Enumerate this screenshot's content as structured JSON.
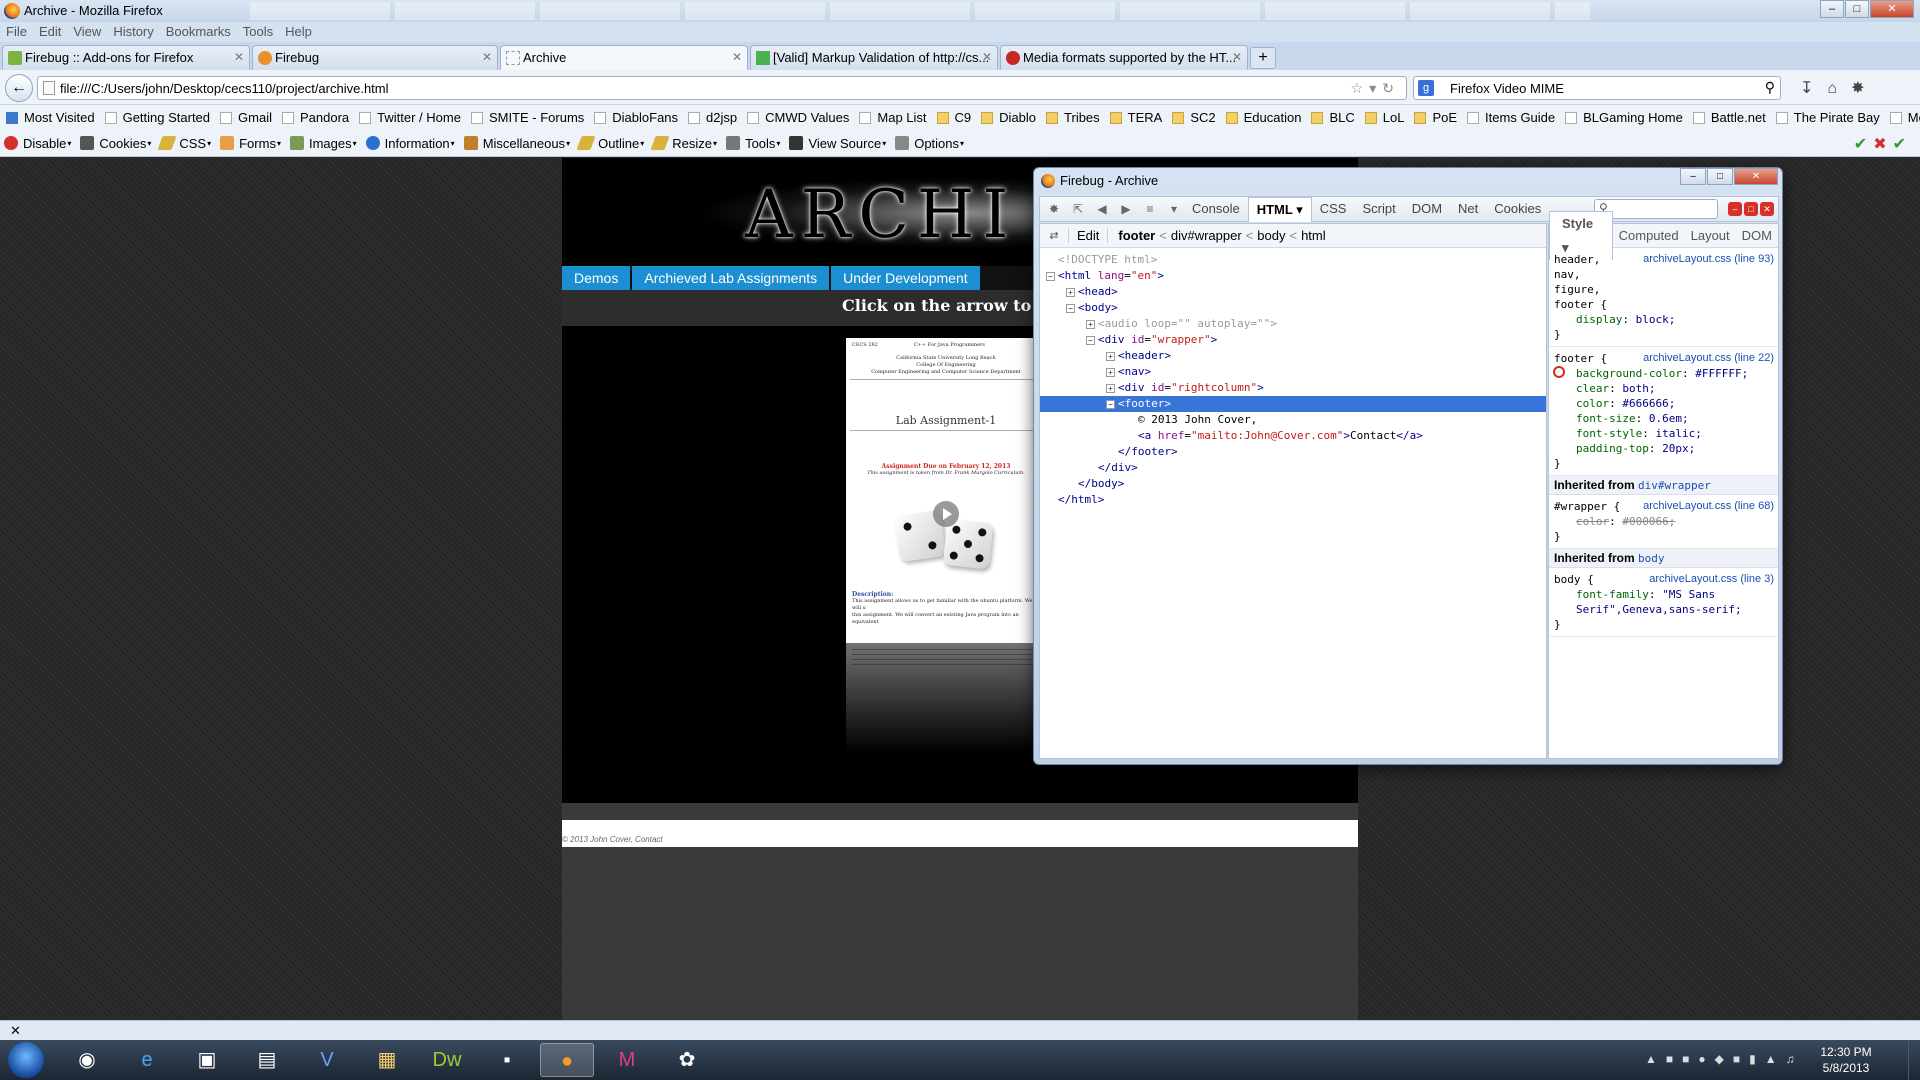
{
  "window": {
    "title": "Archive - Mozilla Firefox"
  },
  "menu": [
    "File",
    "Edit",
    "View",
    "History",
    "Bookmarks",
    "Tools",
    "Help"
  ],
  "tabs": [
    {
      "label": "Firebug :: Add-ons for Firefox"
    },
    {
      "label": "Firebug"
    },
    {
      "label": "Archive"
    },
    {
      "label": "[Valid] Markup Validation of http://cs..."
    },
    {
      "label": "Media formats supported by the HT..."
    }
  ],
  "navbar": {
    "url": "file:///C:/Users/john/Desktop/cecs110/project/archive.html",
    "search_value": "Firefox Video MIME"
  },
  "bookmarks": [
    "Most Visited",
    "Getting Started",
    "Gmail",
    "Pandora",
    "Twitter / Home",
    "SMITE - Forums",
    "DiabloFans",
    "d2jsp",
    "CMWD Values",
    "Map List",
    "C9",
    "Diablo",
    "Tribes",
    "TERA",
    "SC2",
    "Education",
    "BLC",
    "LoL",
    "PoE",
    "Items Guide",
    "BLGaming Home",
    "Battle.net",
    "The Pirate Bay",
    "Movie Showtimes"
  ],
  "devtoolbar": [
    "Disable",
    "Cookies",
    "CSS",
    "Forms",
    "Images",
    "Information",
    "Miscellaneous",
    "Outline",
    "Resize",
    "Tools",
    "View Source",
    "Options"
  ],
  "site": {
    "logo_text": "ARCHI",
    "nav": [
      "Demos",
      "Archieved Lab Assignments",
      "Under Development"
    ],
    "hint": "Click on the arrow to view t",
    "doc": {
      "course_code": "CECS 282",
      "course_name": "C++ For Java Programmers",
      "school": "California State University Long Beach",
      "college": "College Of Engineering",
      "dept": "Computer Engineering and Computer Science Department",
      "heading": "Lab Assignment-1",
      "due": "Assignment Due on February 12, 2013",
      "source_note": "This assignment is taken from Dr. Frank Murgolo Curriculum.",
      "desc_label": "Description:",
      "desc_line1": "This assignment allows us to get familiar with the ubuntu platform. We will u",
      "desc_line2": "this assignment. We will convert an existing Java program into an equivalent"
    },
    "footer": "© 2013 John Cover, Contact"
  },
  "firebug": {
    "title": "Firebug - Archive",
    "panels": [
      "Console",
      "HTML",
      "CSS",
      "Script",
      "DOM",
      "Net",
      "Cookies"
    ],
    "active_panel": "HTML",
    "breadcrumb": {
      "edit": "Edit",
      "path": [
        "footer",
        "div#wrapper",
        "body",
        "html"
      ]
    },
    "tree": [
      {
        "indent": 0,
        "twisty": "",
        "text": "<!DOCTYPE html>",
        "kind": "doctype"
      },
      {
        "indent": 0,
        "twisty": "−",
        "tag": "html",
        "attr": "lang",
        "val": "en"
      },
      {
        "indent": 1,
        "twisty": "+",
        "tag": "head"
      },
      {
        "indent": 1,
        "twisty": "−",
        "tag": "body"
      },
      {
        "indent": 2,
        "twisty": "+",
        "tag": "audio",
        "attrs_text": "loop=\"\" autoplay=\"\"",
        "kind": "gray"
      },
      {
        "indent": 2,
        "twisty": "−",
        "tag": "div",
        "attr": "id",
        "val": "wrapper"
      },
      {
        "indent": 3,
        "twisty": "+",
        "tag": "header"
      },
      {
        "indent": 3,
        "twisty": "+",
        "tag": "nav"
      },
      {
        "indent": 3,
        "twisty": "+",
        "tag": "div",
        "attr": "id",
        "val": "rightcolumn"
      },
      {
        "indent": 3,
        "twisty": "−",
        "tag": "footer",
        "selected": true
      },
      {
        "indent": 4,
        "twisty": "",
        "text": "© 2013 John Cover,",
        "kind": "text"
      },
      {
        "indent": 4,
        "twisty": "",
        "tag": "a",
        "attr": "href",
        "val": "mailto:John@Cover.com",
        "inner": "Contact",
        "close": true
      },
      {
        "indent": 3,
        "twisty": "",
        "text": "</footer>",
        "kind": "closetag"
      },
      {
        "indent": 2,
        "twisty": "",
        "text": "</div>",
        "kind": "closetag"
      },
      {
        "indent": 1,
        "twisty": "",
        "text": "</body>",
        "kind": "closetag"
      },
      {
        "indent": 0,
        "twisty": "",
        "text": "</html>",
        "kind": "closetag"
      }
    ],
    "side_tabs": [
      "Style",
      "Computed",
      "Layout",
      "DOM"
    ],
    "active_side_tab": "Style",
    "rules": [
      {
        "selector": "header,\nnav,\nfigure,\nfooter {",
        "source": "archiveLayout.css (line 93)",
        "props": [
          {
            "name": "display",
            "value": "block;"
          }
        ]
      },
      {
        "selector": "footer {",
        "source": "archiveLayout.css (line 22)",
        "props": [
          {
            "name": "background-color",
            "value": "#FFFFFF;",
            "disabled": true
          },
          {
            "name": "clear",
            "value": "both;"
          },
          {
            "name": "color",
            "value": "#666666;"
          },
          {
            "name": "font-size",
            "value": "0.6em;"
          },
          {
            "name": "font-style",
            "value": "italic;"
          },
          {
            "name": "padding-top",
            "value": "20px;"
          }
        ]
      }
    ],
    "inherited": [
      {
        "label": "Inherited from",
        "from": "div#wrapper",
        "selector": "#wrapper {",
        "source": "archiveLayout.css (line 68)",
        "props": [
          {
            "name": "color",
            "value": "#000066;",
            "overridden": true
          }
        ]
      },
      {
        "label": "Inherited from",
        "from": "body",
        "selector": "body {",
        "source": "archiveLayout.css (line 3)",
        "props": [
          {
            "name": "font-family",
            "value": "\"MS Sans Serif\",Geneva,sans-serif;"
          }
        ]
      }
    ]
  },
  "taskbar": {
    "time": "12:30 PM",
    "date": "5/8/2013",
    "apps": [
      "chrome",
      "internet-explorer",
      "virtualbox",
      "notepad",
      "visio",
      "explorer",
      "dreamweaver",
      "notepad2",
      "firefox",
      "app-magenta",
      "paint"
    ]
  }
}
